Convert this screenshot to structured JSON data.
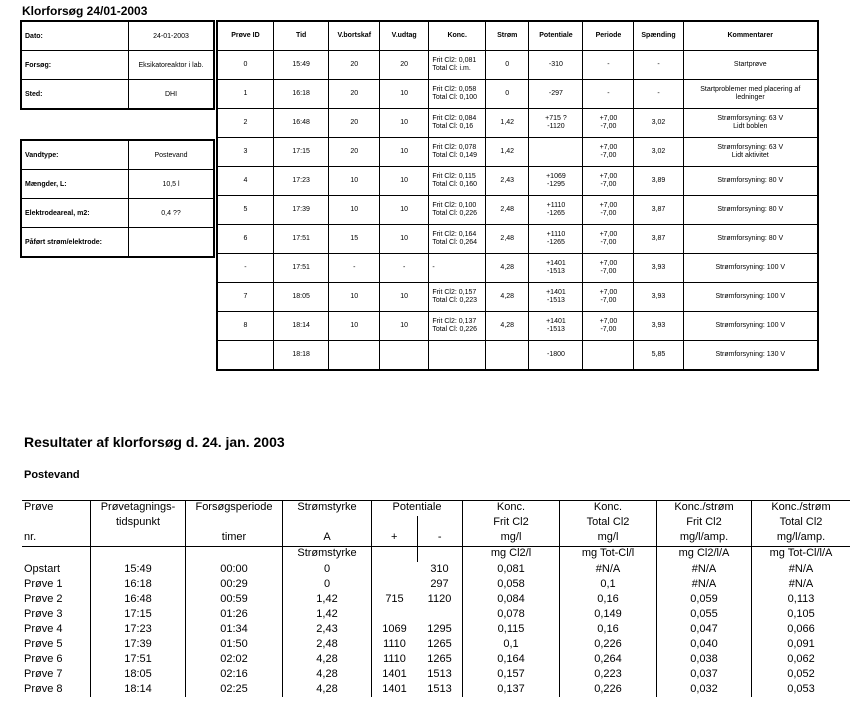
{
  "page_title": "Klorforsøg 24/01-2003",
  "info_top": [
    {
      "label": "Dato:",
      "value": "24-01-2003"
    },
    {
      "label": "Forsøg:",
      "value": "Eksikatoreaktor i lab."
    },
    {
      "label": "Sted:",
      "value": "DHI"
    }
  ],
  "info_bottom": [
    {
      "label": "Vandtype:",
      "value": "Postevand"
    },
    {
      "label": "Mængder, L:",
      "value": "10,5 l"
    },
    {
      "label": "Elektrodeareal, m2:",
      "value": "0,4 ??"
    },
    {
      "label": "Påført strøm/elektrode:",
      "value": ""
    }
  ],
  "main_headers": [
    "Prøve ID",
    "Tid",
    "V.bortskaf",
    "V.udtag",
    "Konc.",
    "Strøm",
    "Potentiale",
    "Periode",
    "Spænding",
    "Kommentarer"
  ],
  "main_rows": [
    [
      "0",
      "15:49",
      "20",
      "20",
      "Frit Cl2: 0,081\nTotal Cl: i.m.",
      "0",
      "-310",
      "-",
      "-",
      "Startprøve"
    ],
    [
      "1",
      "16:18",
      "20",
      "10",
      "Frit Cl2: 0,058\nTotal Cl: 0,100",
      "0",
      "-297",
      "-",
      "-",
      "Startproblemer med placering af\nledninger"
    ],
    [
      "2",
      "16:48",
      "20",
      "10",
      "Frit Cl2: 0,084\nTotal Cl: 0,16",
      "1,42",
      "+715 ?\n-1120",
      "+7,00\n-7,00",
      "3,02",
      "Strømforsyning: 63 V\nLidt boblen"
    ],
    [
      "3",
      "17:15",
      "20",
      "10",
      "Frit Cl2: 0,078\nTotal Cl: 0,149",
      "1,42",
      "",
      "+7,00\n-7,00",
      "3,02",
      "Strømforsyning: 63 V\nLidt aktivitet"
    ],
    [
      "4",
      "17:23",
      "10",
      "10",
      "Frit Cl2: 0,115\nTotal Cl: 0,160",
      "2,43",
      "+1069\n-1295",
      "+7,00\n-7,00",
      "3,89",
      "Strømforsyning: 80 V"
    ],
    [
      "5",
      "17:39",
      "10",
      "10",
      "Frit Cl2: 0,100\nTotal Cl: 0,226",
      "2,48",
      "+1110\n-1265",
      "+7,00\n-7,00",
      "3,87",
      "Strømforsyning: 80 V"
    ],
    [
      "6",
      "17:51",
      "15",
      "10",
      "Frit Cl2: 0,164\nTotal Cl: 0,264",
      "2,48",
      "+1110\n-1265",
      "+7,00\n-7,00",
      "3,87",
      "Strømforsyning: 80 V"
    ],
    [
      "-",
      "17:51",
      "-",
      "-",
      "-",
      "4,28",
      "+1401\n-1513",
      "+7,00\n-7,00",
      "3,93",
      "Strømforsyning: 100 V"
    ],
    [
      "7",
      "18:05",
      "10",
      "10",
      "Frit Cl2: 0,157\nTotal Cl: 0,223",
      "4,28",
      "+1401\n-1513",
      "+7,00\n-7,00",
      "3,93",
      "Strømforsyning: 100 V"
    ],
    [
      "8",
      "18:14",
      "10",
      "10",
      "Frit Cl2: 0,137\nTotal Cl: 0,226",
      "4,28",
      "+1401\n-1513",
      "+7,00\n-7,00",
      "3,93",
      "Strømforsyning: 100 V"
    ],
    [
      "",
      "18:18",
      "",
      "",
      "",
      "",
      "-1800",
      "",
      "5,85",
      "Strømforsyning: 130 V"
    ]
  ],
  "results_title": "Resultater af klorforsøg d. 24. jan. 2003",
  "results_subtitle": "Postevand",
  "results_headers": {
    "h1": [
      "Prøve",
      "Prøvetagnings-",
      "Forsøgsperiode",
      "Strømstyrke",
      "Potentiale",
      "",
      "Konc.",
      "Konc.",
      "Konc./strøm",
      "Konc./strøm"
    ],
    "h2": [
      "",
      "tidspunkt",
      "",
      "",
      "",
      "",
      "Frit Cl2",
      "Total Cl2",
      "Frit Cl2",
      "Total Cl2"
    ],
    "h3": [
      "nr.",
      "",
      "timer",
      "A",
      "+",
      "-",
      "mg/l",
      "mg/l",
      "mg/l/amp.",
      "mg/l/amp."
    ],
    "h4": [
      "",
      "",
      "",
      "Strømstyrke",
      "",
      "",
      "mg Cl2/l",
      "mg Tot-Cl/l",
      "mg Cl2/l/A",
      "mg Tot-Cl/l/A"
    ]
  },
  "results_rows": [
    [
      "Opstart",
      "15:49",
      "00:00",
      "0",
      "",
      "310",
      "0,081",
      "#N/A",
      "#N/A",
      "#N/A"
    ],
    [
      "Prøve 1",
      "16:18",
      "00:29",
      "0",
      "",
      "297",
      "0,058",
      "0,1",
      "#N/A",
      "#N/A"
    ],
    [
      "Prøve 2",
      "16:48",
      "00:59",
      "1,42",
      "715",
      "1120",
      "0,084",
      "0,16",
      "0,059",
      "0,113"
    ],
    [
      "Prøve 3",
      "17:15",
      "01:26",
      "1,42",
      "",
      "",
      "0,078",
      "0,149",
      "0,055",
      "0,105"
    ],
    [
      "Prøve 4",
      "17:23",
      "01:34",
      "2,43",
      "1069",
      "1295",
      "0,115",
      "0,16",
      "0,047",
      "0,066"
    ],
    [
      "Prøve 5",
      "17:39",
      "01:50",
      "2,48",
      "1110",
      "1265",
      "0,1",
      "0,226",
      "0,040",
      "0,091"
    ],
    [
      "Prøve 6",
      "17:51",
      "02:02",
      "4,28",
      "1110",
      "1265",
      "0,164",
      "0,264",
      "0,038",
      "0,062"
    ],
    [
      "Prøve 7",
      "18:05",
      "02:16",
      "4,28",
      "1401",
      "1513",
      "0,157",
      "0,223",
      "0,037",
      "0,052"
    ],
    [
      "Prøve 8",
      "18:14",
      "02:25",
      "4,28",
      "1401",
      "1513",
      "0,137",
      "0,226",
      "0,032",
      "0,053"
    ]
  ]
}
